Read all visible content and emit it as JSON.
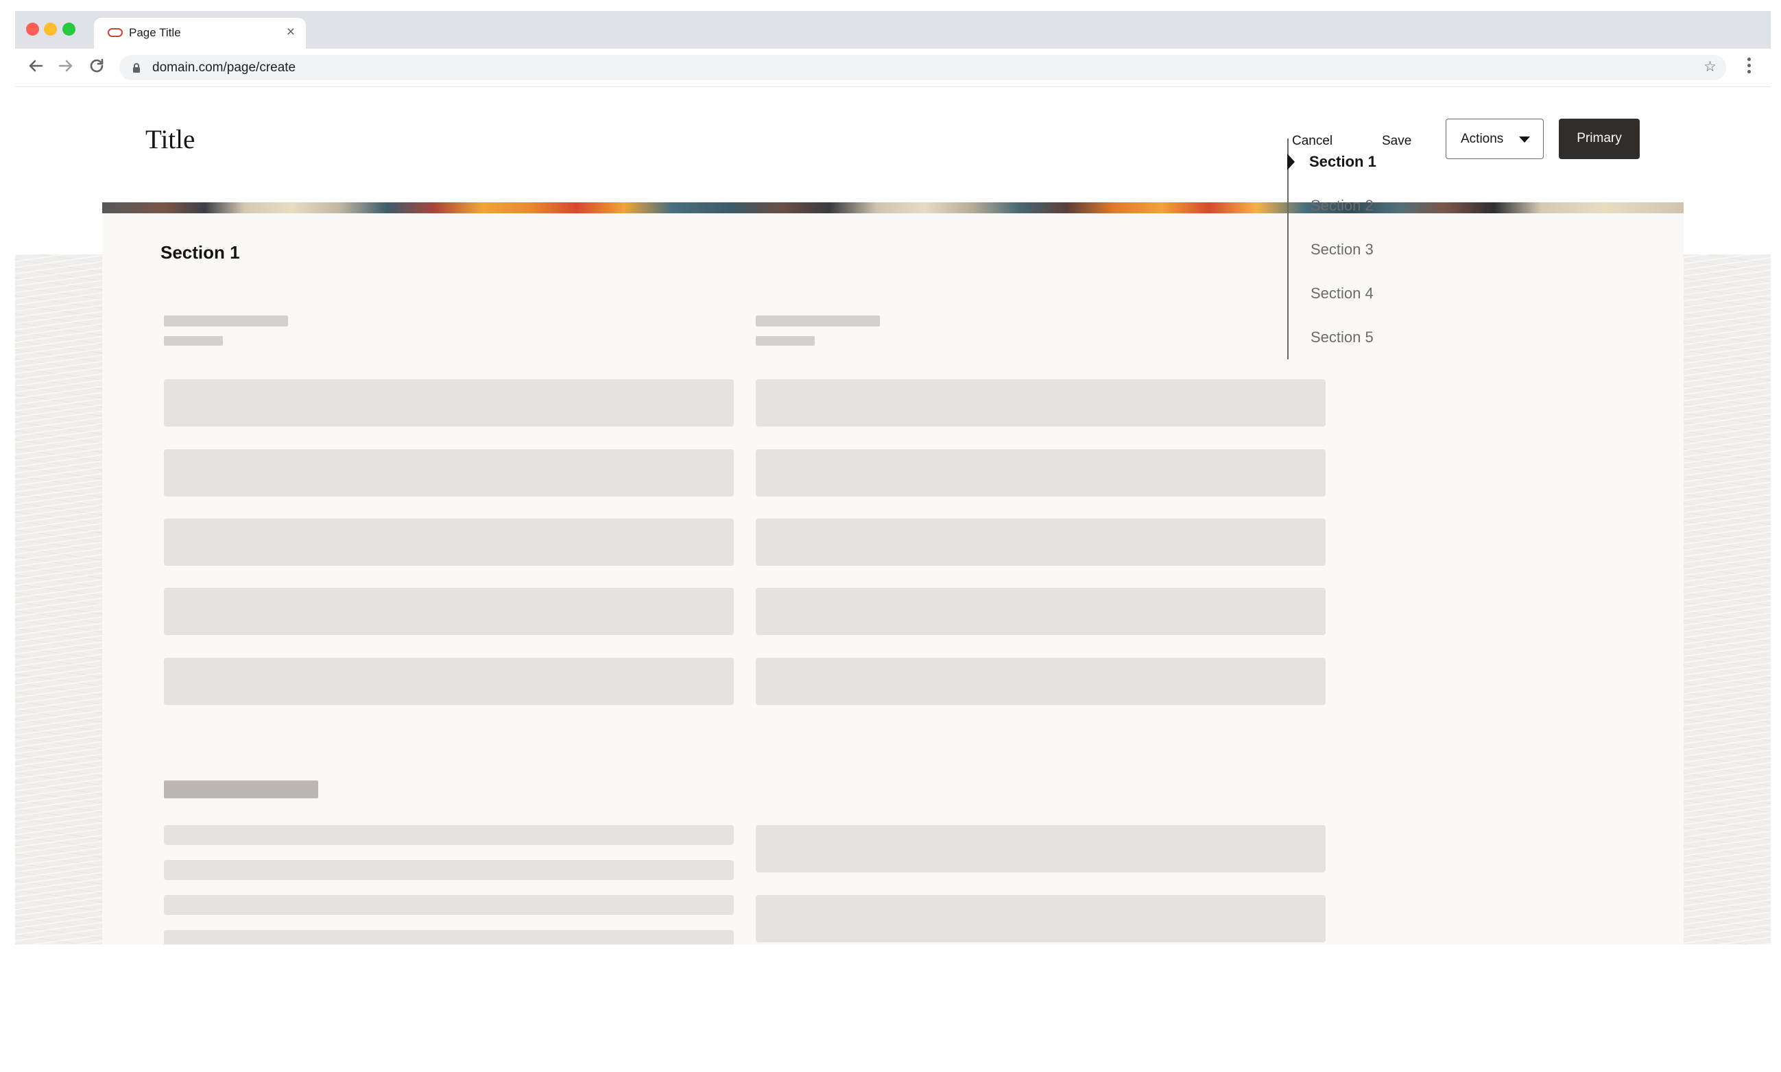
{
  "browser": {
    "tab": {
      "title": "Page Title",
      "close_glyph": "×",
      "favicon": "oracle-oval-icon"
    },
    "address": {
      "url": "domain.com/page/create"
    },
    "icons": {
      "back": "arrow-left-icon",
      "forward": "arrow-right-icon",
      "reload": "reload-icon",
      "lock": "lock-icon",
      "bookmark": "star-icon",
      "menu": "kebab-menu-icon"
    },
    "bookmark_glyph": "☆"
  },
  "header": {
    "title": "Title",
    "cancel_label": "Cancel",
    "save_label": "Save",
    "actions_label": "Actions",
    "primary_label": "Primary"
  },
  "content": {
    "section_title": "Section 1"
  },
  "section_nav": {
    "items": [
      {
        "label": "Section 1",
        "active": true
      },
      {
        "label": "Section 2",
        "active": false
      },
      {
        "label": "Section 3",
        "active": false
      },
      {
        "label": "Section 4",
        "active": false
      },
      {
        "label": "Section 5",
        "active": false
      }
    ]
  },
  "colors": {
    "primary_button": "#312d2a",
    "card_background": "#faf9f8",
    "skeleton": "#e5e2df",
    "text": "#161513",
    "muted_text": "#6f6a66"
  }
}
